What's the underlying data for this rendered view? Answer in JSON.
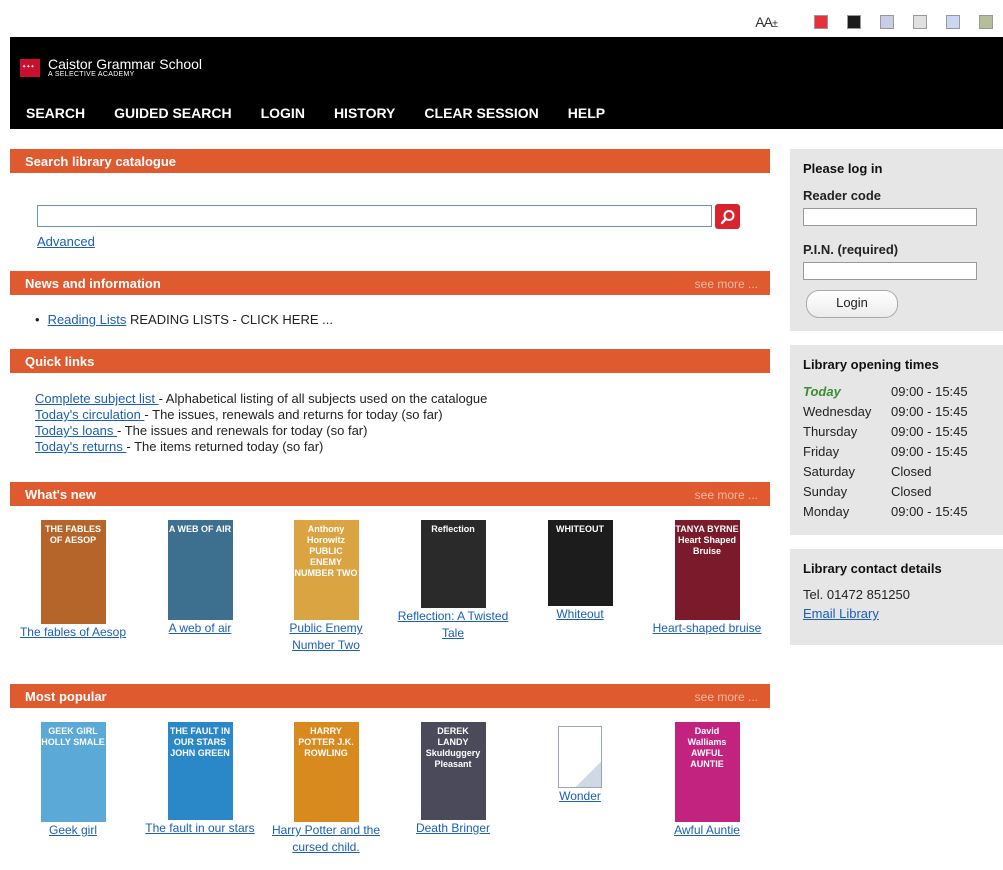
{
  "accessibility": {
    "font_size_label": "AA",
    "font_size_suffix": "±",
    "swatches": [
      "#e8303a",
      "#1a1a1a",
      "#c8cce6",
      "#e0e0e0",
      "#c9d7f0",
      "#b5bd9a"
    ]
  },
  "header": {
    "school_name": "Caistor Grammar School",
    "school_subtitle": "A SELECTIVE ACADEMY",
    "nav": [
      "SEARCH",
      "GUIDED SEARCH",
      "LOGIN",
      "HISTORY",
      "CLEAR SESSION",
      "HELP"
    ]
  },
  "search": {
    "title": "Search library catalogue",
    "value": "",
    "advanced": "Advanced"
  },
  "news": {
    "title": "News and information",
    "see_more": "see more ...",
    "item_link": "Reading Lists",
    "item_text": "READING LISTS - CLICK HERE ..."
  },
  "quick_links": {
    "title": "Quick links",
    "items": [
      {
        "link": "Complete subject list ",
        "desc": "- Alphabetical listing of all subjects used on the catalogue"
      },
      {
        "link": "Today's circulation ",
        "desc": "- The issues, renewals and returns for today (so far)"
      },
      {
        "link": "Today's loans ",
        "desc": "- The issues and renewals for today (so far)"
      },
      {
        "link": "Today's returns ",
        "desc": "- The items returned today (so far)"
      }
    ]
  },
  "whats_new": {
    "title": "What's new",
    "see_more": "see more ...",
    "books": [
      {
        "title_line1": "The fables of Aesop",
        "title_line2": "",
        "cover_text": "THE FABLES OF AESOP",
        "cover_color": "#b5652a"
      },
      {
        "title_line1": "A web of air",
        "title_line2": "",
        "cover_text": "A WEB OF AIR",
        "cover_color": "#3d6f8e"
      },
      {
        "title_line1": "Public Enemy",
        "title_line2": "Number Two",
        "cover_text": "Anthony Horowitz PUBLIC ENEMY NUMBER TWO",
        "cover_color": "#d9a441"
      },
      {
        "title_line1": "Reflection: A Twisted",
        "title_line2": "Tale",
        "cover_text": "Reflection",
        "cover_color": "#2a2a2a"
      },
      {
        "title_line1": "Whiteout",
        "title_line2": "",
        "cover_text": "WHITEOUT",
        "cover_color": "#1c1c1c"
      },
      {
        "title_line1": "Heart-shaped bruise",
        "title_line2": "",
        "cover_text": "TANYA BYRNE Heart Shaped Bruise",
        "cover_color": "#7a1a2a"
      }
    ]
  },
  "most_popular": {
    "title": "Most popular",
    "see_more": "see more ...",
    "books": [
      {
        "title_line1": "Geek girl",
        "title_line2": "",
        "cover_text": "GEEK GIRL HOLLY SMALE",
        "cover_color": "#5aa9d6"
      },
      {
        "title_line1": "The fault in our stars",
        "title_line2": "",
        "cover_text": "THE FAULT IN OUR STARS JOHN GREEN",
        "cover_color": "#2b88c8"
      },
      {
        "title_line1": "Harry Potter and the",
        "title_line2": "cursed child.",
        "cover_text": "HARRY POTTER J.K. ROWLING",
        "cover_color": "#d88a1e"
      },
      {
        "title_line1": "Death Bringer",
        "title_line2": "",
        "cover_text": "DEREK LANDY Skulduggery Pleasant",
        "cover_color": "#4a4a5a"
      },
      {
        "title_line1": "Wonder",
        "title_line2": "",
        "cover_text": "",
        "cover_color": "#ffffff"
      },
      {
        "title_line1": "Awful Auntie",
        "title_line2": "",
        "cover_text": "David Walliams AWFUL AUNTIE",
        "cover_color": "#c2237e"
      }
    ]
  },
  "login_panel": {
    "title": "Please log in",
    "reader_code_label": "Reader code",
    "pin_label": "P.I.N. (required)",
    "login_button": "Login"
  },
  "opening_times": {
    "title": "Library opening times",
    "rows": [
      {
        "day": "Today",
        "hours": "09:00 - 15:45"
      },
      {
        "day": "Wednesday",
        "hours": "09:00 - 15:45"
      },
      {
        "day": "Thursday",
        "hours": "09:00 - 15:45"
      },
      {
        "day": "Friday",
        "hours": "09:00 - 15:45"
      },
      {
        "day": "Saturday",
        "hours": "Closed"
      },
      {
        "day": "Sunday",
        "hours": "Closed"
      },
      {
        "day": "Monday",
        "hours": "09:00 - 15:45"
      }
    ]
  },
  "contact": {
    "title": "Library contact details",
    "tel": "Tel.  01472 851250",
    "email": "Email Library"
  }
}
